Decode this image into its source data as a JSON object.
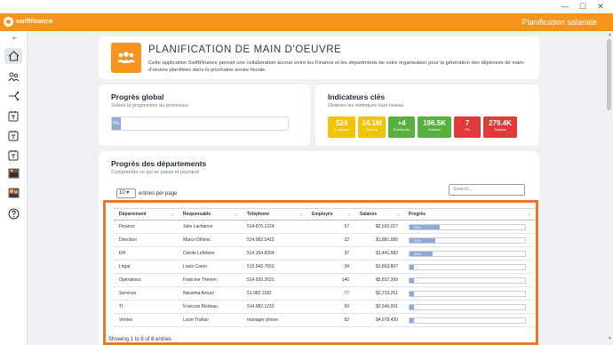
{
  "app": {
    "logo_text": "swiftfinance",
    "title": "Planification salariale"
  },
  "window": {
    "minimize": "—",
    "maximize": "☐",
    "close": "✕"
  },
  "header": {
    "title": "PLANIFICATION DE MAIN D'OEUVRE",
    "description": "Cette application SwiftFinance permet une collaboration accrue entre les Finance et les départments de votre organisation pour la génération des dépenses de main-d'oeuvre planifiées dans la prochaine année fiscale."
  },
  "global_progress": {
    "title": "Progrès global",
    "subtitle": "Suivez la progression du processus",
    "percent": 5,
    "label": "5%"
  },
  "kpi_section": {
    "title": "Indicateurs clés",
    "subtitle": "Obtenez les métriques haut niveau",
    "items": [
      {
        "value": "524",
        "label": "Employés",
        "color": "#f2c300"
      },
      {
        "value": "24.1M",
        "label": "Salaires",
        "color": "#f2c300"
      },
      {
        "value": "+4",
        "label": "Embauche",
        "color": "#58b13e"
      },
      {
        "value": "196.5K",
        "label": "Salaires",
        "color": "#58b13e"
      },
      {
        "value": "7",
        "label": "Fin",
        "color": "#e03a3a"
      },
      {
        "value": "279.4K",
        "label": "Salaires",
        "color": "#e03a3a"
      }
    ]
  },
  "departments": {
    "title": "Progrès des départements",
    "subtitle": "Comprendre ce qui se passe et pourquoi",
    "length_value": "10",
    "length_label": "entries per page",
    "search_placeholder": "Search...",
    "columns": [
      "Département",
      "Responsable",
      "Téléphone",
      "Employés",
      "Salaires",
      "Progrès"
    ],
    "rows": [
      {
        "dept": "Finance",
        "manager": "Julie Lachance",
        "phone": "514.876.1224",
        "employees": "57",
        "salaries": "$2,592,027",
        "progress": 26,
        "progress_label": "26%"
      },
      {
        "dept": "Direction",
        "manager": "Marco Dihinni",
        "phone": "514.982.5413",
        "employees": "22",
        "salaries": "$1,881,580",
        "progress": 22,
        "progress_label": "22%"
      },
      {
        "dept": "RH",
        "manager": "Carole Lefebvre",
        "phone": "514.154.8304",
        "employees": "37",
        "salaries": "$1,441,582",
        "progress": 20,
        "progress_label": "20%"
      },
      {
        "dept": "Légal",
        "manager": "Louis Caron",
        "phone": "515.543.7653",
        "employees": "34",
        "salaries": "$1,863,807",
        "progress": 0,
        "progress_label": ""
      },
      {
        "dept": "Opérations",
        "manager": "Francine Thérien",
        "phone": "514.920.2621",
        "employees": "146",
        "salaries": "$5,837,399",
        "progress": 0,
        "progress_label": ""
      },
      {
        "dept": "Services",
        "manager": "Nassima Amuni",
        "phone": "51.982.1182",
        "employees": "77",
        "salaries": "$2,733,261",
        "progress": 0,
        "progress_label": ""
      },
      {
        "dept": "TI",
        "manager": "Francois Blodeau",
        "phone": "514.982.1233",
        "employees": "69",
        "salaries": "$2,546,991",
        "progress": 0,
        "progress_label": ""
      },
      {
        "dept": "Ventes",
        "manager": "Lucie Trahan",
        "phone": "manager phone",
        "employees": "92",
        "salaries": "$4,978,430",
        "progress": 0,
        "progress_label": ""
      }
    ],
    "info": "Showing 1 to 8 of 8 entries"
  }
}
